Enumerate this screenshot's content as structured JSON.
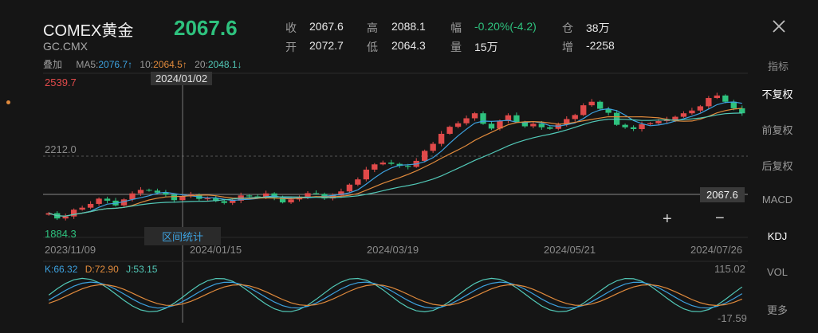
{
  "header": {
    "symbol": "COMEX黄金",
    "code": "GC.CMX",
    "last_price": "2067.6",
    "quote_labels": {
      "close": "收",
      "open": "开",
      "high": "高",
      "low": "低",
      "change": "幅",
      "volume": "量",
      "oi": "仓",
      "oi_change": "增"
    },
    "quote_values": {
      "close": "2067.6",
      "open": "2072.7",
      "high": "2088.1",
      "low": "2064.3",
      "change": "-0.20%(-4.2)",
      "volume": "15万",
      "oi": "38万",
      "oi_change": "-2258"
    }
  },
  "ma_bar": {
    "overlay_label": "叠加",
    "ma5_label": "MA5:",
    "ma5_value": "2076.7↑",
    "ma10_label": "10:",
    "ma10_value": "2064.5↑",
    "ma20_label": "20:",
    "ma20_value": "2048.1↓"
  },
  "side_menu": {
    "title": "指标",
    "items": [
      "不复权",
      "前复权",
      "后复权",
      "MACD",
      "KDJ",
      "VOL",
      "更多"
    ],
    "active": [
      "不复权",
      "KDJ"
    ]
  },
  "chart": {
    "y_max_label": "2539.7",
    "y_mid_label": "2212.0",
    "y_min_label": "1884.3",
    "crosshair_date": "2024/01/02",
    "current_price_tag": "2067.6",
    "stat_button": "区间统计",
    "zoom_in": "+",
    "zoom_out": "−",
    "x_labels": [
      "2023/11/09",
      "2024/01/15",
      "2024/03/19",
      "2024/05/21",
      "2024/07/26"
    ],
    "colors": {
      "up": "#e04a4a",
      "down": "#2ec27e",
      "ma5": "#3da2e0",
      "ma10": "#e08a3c",
      "ma20": "#52c9b8"
    }
  },
  "kdj": {
    "k": "K:66.32",
    "d": "D:72.90",
    "j": "J:53.15",
    "max_label": "115.02",
    "min_label": "-17.59"
  },
  "chart_data": {
    "type": "candlestick",
    "ylim": [
      1884.3,
      2539.7
    ],
    "reference_line": 2212.0,
    "last_price_line": 2067.6,
    "closes": [
      1981,
      1960,
      1968,
      1995,
      2003,
      2018,
      2039,
      2031,
      2012,
      2036,
      2060,
      2074,
      2071,
      2063,
      2055,
      2033,
      2048,
      2055,
      2038,
      2040,
      2029,
      2022,
      2031,
      2052,
      2048,
      2045,
      2060,
      2043,
      2024,
      2036,
      2047,
      2061,
      2058,
      2040,
      2052,
      2068,
      2095,
      2116,
      2155,
      2176,
      2183,
      2178,
      2170,
      2166,
      2190,
      2230,
      2258,
      2298,
      2326,
      2340,
      2360,
      2380,
      2338,
      2319,
      2350,
      2372,
      2345,
      2328,
      2338,
      2324,
      2318,
      2335,
      2357,
      2373,
      2412,
      2426,
      2398,
      2382,
      2334,
      2324,
      2317,
      2336,
      2340,
      2349,
      2355,
      2366,
      2380,
      2391,
      2408,
      2441,
      2451,
      2426,
      2400,
      2380
    ]
  }
}
